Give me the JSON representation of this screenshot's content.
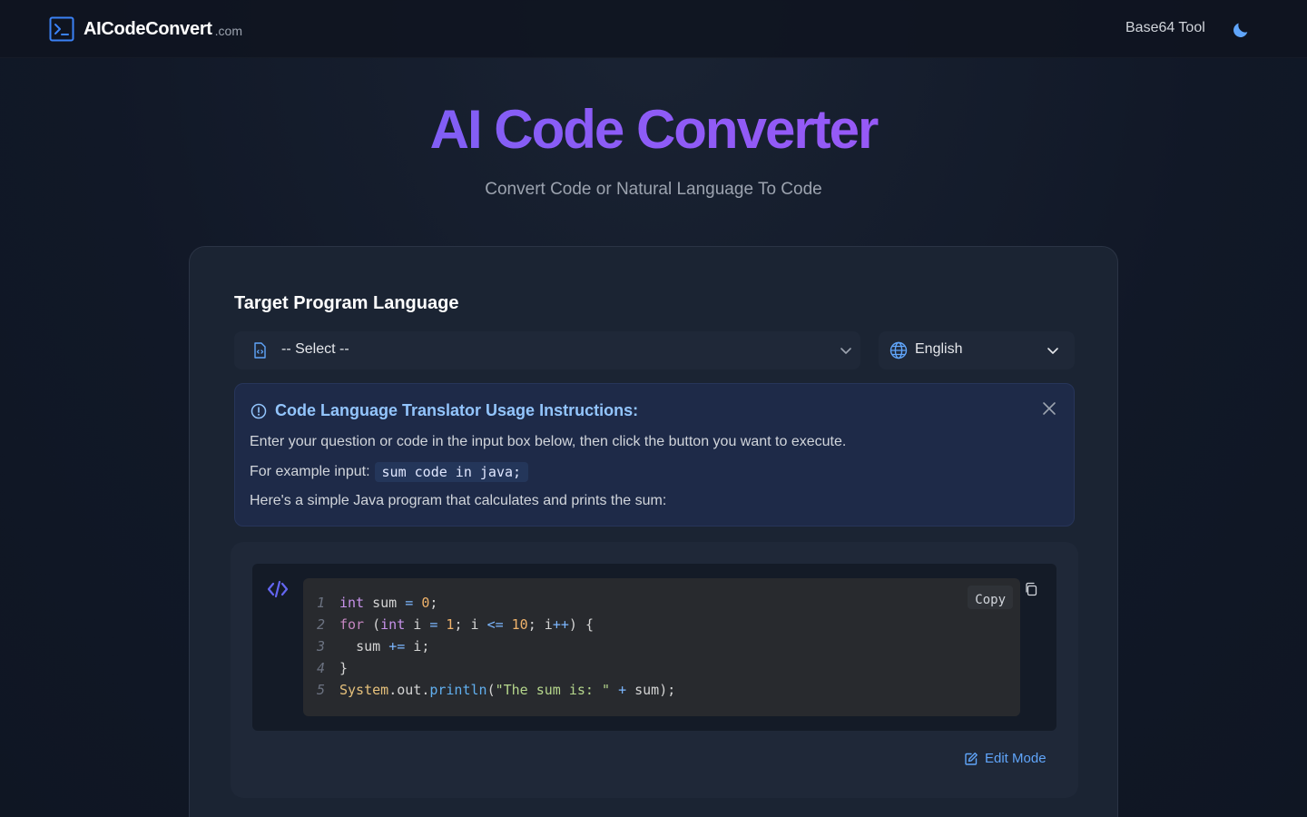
{
  "header": {
    "brand_name": "AICodeConvert",
    "brand_suffix": ".com",
    "nav_link": "Base64 Tool",
    "theme_icon": "moon-icon"
  },
  "hero": {
    "title": "AI Code Converter",
    "subtitle": "Convert Code or Natural Language To Code"
  },
  "form": {
    "section_label": "Target Program Language",
    "language_select": {
      "value": "-- Select --",
      "icon": "file-code-icon"
    },
    "locale_select": {
      "value": "English",
      "icon": "globe-icon"
    }
  },
  "instructions": {
    "title": "Code Language Translator Usage Instructions:",
    "line1": "Enter your question or code in the input box below, then click the button you want to execute.",
    "line2_prefix": "For example input:",
    "line2_code": "sum code in java;",
    "line3": "Here's a simple Java program that calculates and prints the sum:"
  },
  "code_block": {
    "copy_label": "Copy",
    "line_numbers": [
      "1",
      "2",
      "3",
      "4",
      "5"
    ],
    "lines": [
      "int sum = 0;",
      "for (int i = 1; i <= 10; i++) {",
      "  sum += i;",
      "}",
      "System.out.println(\"The sum is: \" + sum);"
    ]
  },
  "edit_mode_label": "Edit Mode",
  "colors": {
    "accent_blue": "#3b82f6",
    "title_gradient_start": "#6366f1",
    "title_gradient_end": "#a855f7",
    "card_bg": "#1b2433",
    "alert_bg": "#1e2a48",
    "link_blue": "#60a5fa"
  }
}
